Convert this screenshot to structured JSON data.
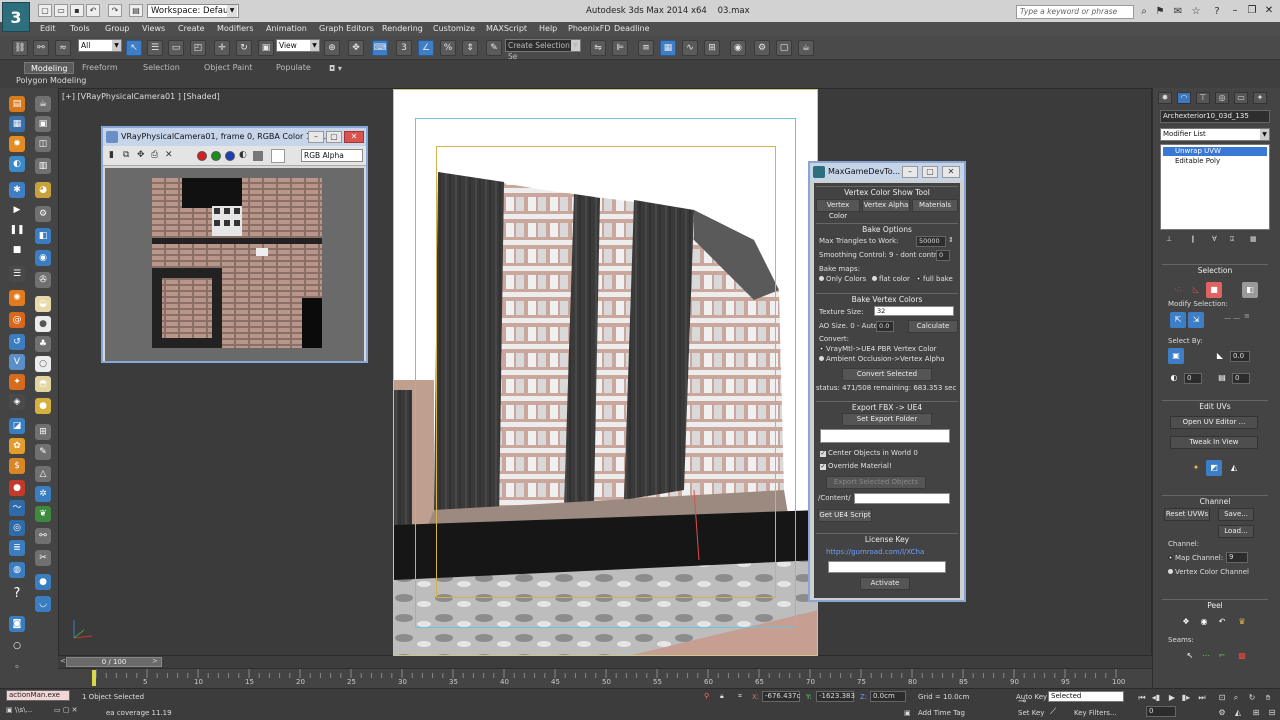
{
  "titlebar": {
    "title": "Autodesk 3ds Max 2014 x64",
    "file": "03.max",
    "workspace": "Workspace: Default",
    "search_placeholder": "Type a keyword or phrase"
  },
  "menu": [
    "Edit",
    "Tools",
    "Group",
    "Views",
    "Create",
    "Modifiers",
    "Animation",
    "Graph Editors",
    "Rendering",
    "Customize",
    "MAXScript",
    "Help",
    "PhoenixFD",
    "Deadline"
  ],
  "toolbar": {
    "selection_filter": "All",
    "reference_coord": "View",
    "named_selection": "Create Selection Se"
  },
  "ribbon": {
    "tabs": [
      "Modeling",
      "Freeform",
      "Selection",
      "Object Paint",
      "Populate"
    ],
    "sub_label": "Polygon Modeling"
  },
  "viewport": {
    "label": "[+] [VRayPhysicalCamera01 ] [Shaded]"
  },
  "vfb": {
    "title": "VRayPhysicalCamera01, frame 0, RGBA Color 16 ...",
    "channel": "RGB Alpha"
  },
  "mgdt": {
    "title": "MaxGameDevTo...",
    "vertex_color_header": "Vertex Color Show Tool",
    "tab_buttons": [
      "Vertex Color",
      "Vertex Alpha",
      "Materials"
    ],
    "bake_options_header": "Bake Options",
    "max_triangles_label": "Max Triangles to Work:",
    "max_triangles_value": "50000",
    "smoothing_label": "Smoothing Control: 9 - dont control",
    "smoothing_value": "0",
    "bake_maps_label": "Bake maps:",
    "bake_maps_options": [
      "Only Colors",
      "flat color",
      "full bake"
    ],
    "bake_vertex_header": "Bake Vertex Colors",
    "texture_size_label": "Texture Size:",
    "texture_size_value": "32",
    "ao_size_label": "AO Size. 0 - Auto",
    "ao_size_value": "0.0",
    "calculate_label": "Calculate",
    "convert_label": "Convert:",
    "convert_options": [
      "VrayMtl->UE4 PBR Vertex Color",
      "Ambient Occlusion->Vertex Alpha"
    ],
    "convert_selected_label": "Convert Selected",
    "status_text": "status: 471/508    remaining: 683.353 sec",
    "export_header": "Export FBX -> UE4",
    "set_export_folder_label": "Set Export Folder",
    "center_objects_label": "Center Objects in World 0",
    "override_material_label": "Override Material!",
    "export_selected_label": "Export Selected Objects",
    "content_label": "/Content/",
    "get_script_label": "Get UE4 Script",
    "license_header": "License Key",
    "license_link": "https://gumroad.com/l/XCha",
    "activate_label": "Activate"
  },
  "cmd_panel": {
    "object_name": "Archexterior10_03d_135",
    "modifier_list": "Modifier List",
    "stack": [
      "Unwrap UVW",
      "Editable Poly"
    ],
    "selection_header": "Selection",
    "modify_selection_label": "Modify Selection:",
    "select_by_label": "Select By:",
    "select_by_value1": "0.0",
    "select_by_value2": "0",
    "select_by_value3": "0",
    "edit_uvs_header": "Edit UVs",
    "open_uv_editor_label": "Open UV Editor ...",
    "tweak_in_view_label": "Tweak In View",
    "channel_header": "Channel",
    "reset_uvws_label": "Reset UVWs",
    "save_label": "Save...",
    "load_label": "Load...",
    "channel_label": "Channel:",
    "map_channel_label": "Map Channel:",
    "map_channel_value": "9",
    "vertex_color_channel_label": "Vertex Color Channel",
    "peel_header": "Peel",
    "seams_label": "Seams:"
  },
  "timeline": {
    "frame_display": "0 / 100",
    "ticks": [
      "0",
      "5",
      "10",
      "15",
      "20",
      "25",
      "30",
      "35",
      "40",
      "45",
      "50",
      "55",
      "60",
      "65",
      "70",
      "75",
      "80",
      "85",
      "90",
      "95",
      "100"
    ]
  },
  "status": {
    "script_listener": "actionMan.exe",
    "objects_selected": "1 Object Selected",
    "coverage_text": "ea coverage 11.19",
    "x_value": "-676.437c",
    "y_value": "-1623.383",
    "z_value": "0.0cm",
    "grid_label": "Grid = 10.0cm",
    "add_time_tag": "Add Time Tag",
    "auto_key": "Auto Key",
    "set_key": "Set Key",
    "key_mode": "Selected",
    "key_filters": "Key Filters...",
    "current_frame": "0"
  },
  "colors": {
    "accent": "#3e7ec6",
    "safe_frame": "#6cc6d8",
    "action_frame": "#d4b34a"
  }
}
